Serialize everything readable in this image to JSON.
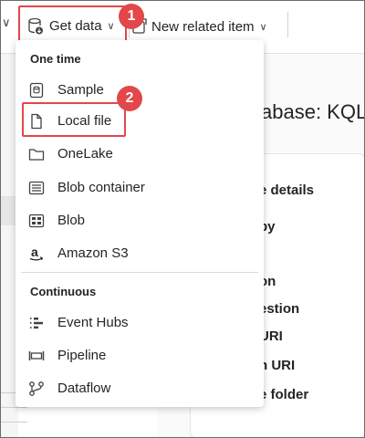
{
  "toolbar": {
    "get_data_label": "Get data",
    "new_related_item_label": "New related item",
    "chevron": "∨",
    "left_chevron": "∨"
  },
  "badges": {
    "step1": "1",
    "step2": "2",
    "color": "#e2474a"
  },
  "background": {
    "title": "abase: KQL",
    "labels": [
      "e details",
      "by",
      "on",
      "estion",
      "URI",
      "n URI",
      "e folder"
    ]
  },
  "menu": {
    "sections": [
      {
        "header": "One time",
        "items": [
          {
            "label": "Sample",
            "icon": "sample-icon"
          },
          {
            "label": "Local file",
            "icon": "file-icon"
          },
          {
            "label": "OneLake",
            "icon": "folder-icon"
          },
          {
            "label": "Blob container",
            "icon": "blob-container-icon"
          },
          {
            "label": "Blob",
            "icon": "blob-icon"
          },
          {
            "label": "Amazon S3",
            "icon": "amazon-icon"
          }
        ]
      },
      {
        "header": "Continuous",
        "items": [
          {
            "label": "Event Hubs",
            "icon": "event-hubs-icon"
          },
          {
            "label": "Pipeline",
            "icon": "pipeline-icon"
          },
          {
            "label": "Dataflow",
            "icon": "dataflow-icon"
          }
        ]
      }
    ]
  }
}
